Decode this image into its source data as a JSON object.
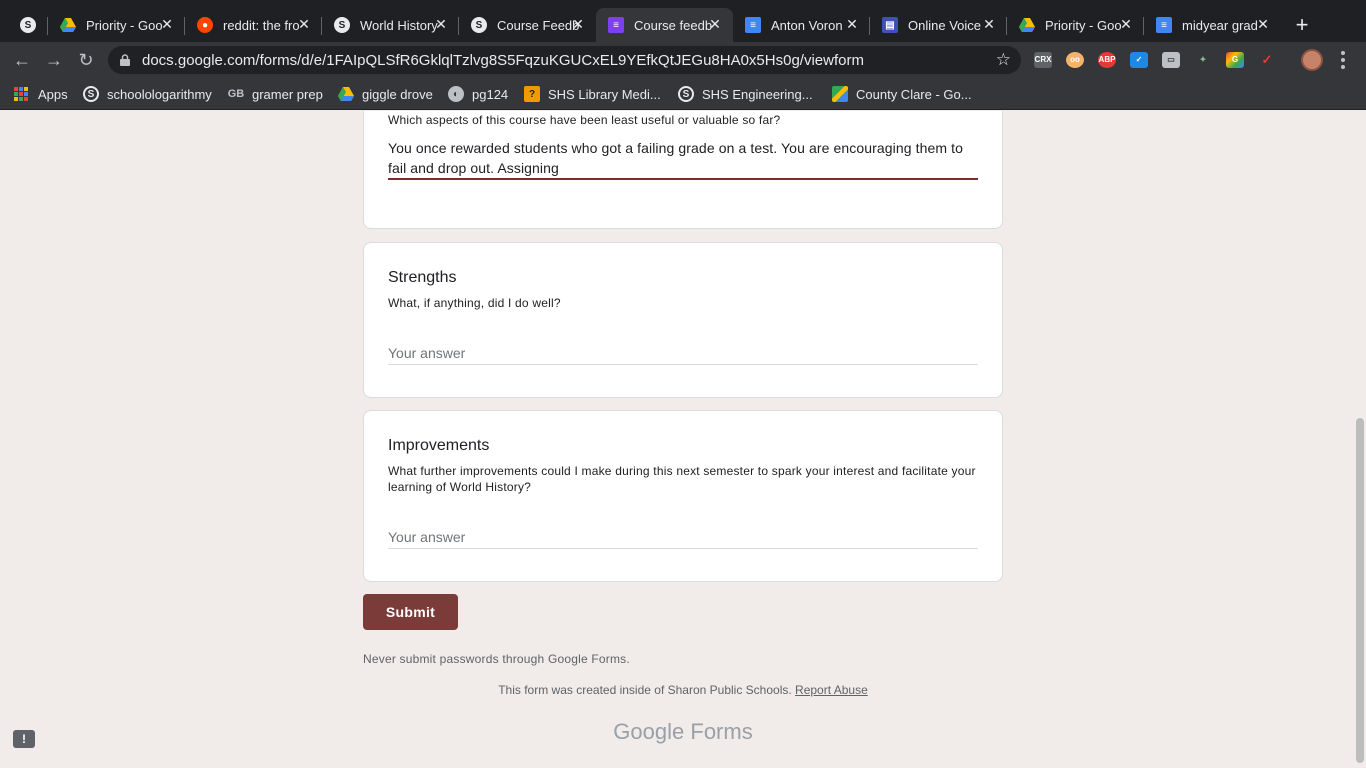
{
  "browser": {
    "tabs": [
      {
        "title": "",
        "icon": "schoology-icon"
      },
      {
        "title": "Priority - Goo",
        "icon": "google-drive-icon"
      },
      {
        "title": "reddit: the fro",
        "icon": "reddit-icon"
      },
      {
        "title": "World History",
        "icon": "schoology-icon"
      },
      {
        "title": "Course Feedb",
        "icon": "schoology-icon"
      },
      {
        "title": "Course feedb",
        "icon": "google-forms-icon"
      },
      {
        "title": "Anton Voron",
        "icon": "google-docs-icon"
      },
      {
        "title": "Online Voice",
        "icon": "voice-recorder-icon"
      },
      {
        "title": "Priority - Goo",
        "icon": "google-drive-icon"
      },
      {
        "title": "midyear grad",
        "icon": "google-docs-icon"
      }
    ],
    "url": "docs.google.com/forms/d/e/1FAIpQLSfR6GklqlTzlvg8S5FqzuKGUCxEL9YEfkQtJEGu8HA0x5Hs0g/viewform",
    "bookmarks": [
      {
        "label": "Apps",
        "icon": "apps-grid-icon"
      },
      {
        "label": "schoolologarithmy",
        "icon": "schoology-icon"
      },
      {
        "label": "gramer prep",
        "icon": "gb-icon"
      },
      {
        "label": "giggle drove",
        "icon": "google-drive-icon"
      },
      {
        "label": "pg124",
        "icon": "globe-icon"
      },
      {
        "label": "SHS Library Medi...",
        "icon": "library-icon"
      },
      {
        "label": "SHS Engineering...",
        "icon": "schoology-icon"
      },
      {
        "label": "County Clare - Go...",
        "icon": "google-maps-icon"
      }
    ]
  },
  "form": {
    "questions": [
      {
        "title": "",
        "description": "Which aspects of this course have been least useful or valuable so far?",
        "answer": "You once rewarded students who got a failing grade on a test. You are encouraging them to fail and drop out. Assigning"
      },
      {
        "title": "Strengths",
        "description": "What, if anything, did I do well?",
        "placeholder": "Your answer"
      },
      {
        "title": "Improvements",
        "description": "What further improvements could I make during this next semester to spark your interest and facilitate your learning of World History?",
        "placeholder": "Your answer"
      }
    ],
    "submit_label": "Submit",
    "password_notice": "Never submit passwords through Google Forms.",
    "created_notice": "This form was created inside of Sharon Public Schools.",
    "report_abuse": "Report Abuse",
    "brand_google": "Google",
    "brand_forms": "Forms",
    "feedback_icon": "!"
  },
  "colors": {
    "accent": "#7b3b38",
    "page_bg": "#f1ebea",
    "chrome_dark": "#35363a"
  }
}
